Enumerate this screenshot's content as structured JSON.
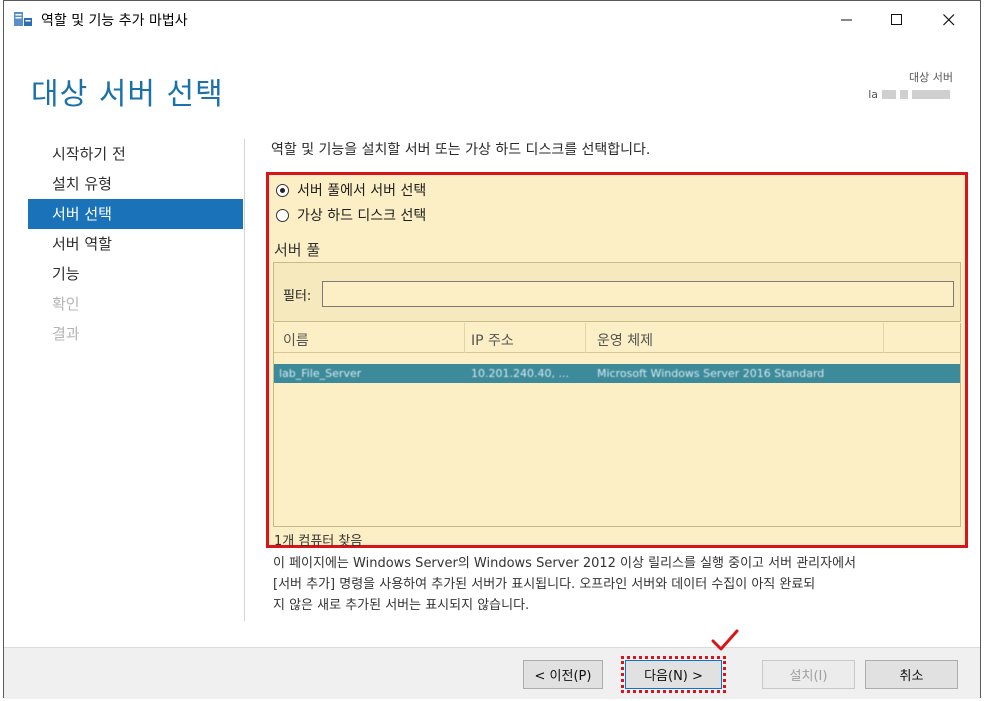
{
  "window": {
    "title": "역할 및 기능 추가 마법사"
  },
  "header": {
    "title": "대상 서버 선택",
    "dest_label": "대상 서버",
    "dest_value": "la"
  },
  "nav": {
    "items": [
      {
        "label": "시작하기 전",
        "state": "normal"
      },
      {
        "label": "설치 유형",
        "state": "normal"
      },
      {
        "label": "서버 선택",
        "state": "active"
      },
      {
        "label": "서버 역할",
        "state": "normal"
      },
      {
        "label": "기능",
        "state": "normal"
      },
      {
        "label": "확인",
        "state": "disabled"
      },
      {
        "label": "결과",
        "state": "disabled"
      }
    ]
  },
  "main": {
    "intro": "역할 및 기능을 설치할 서버 또는 가상 하드 디스크를 선택합니다.",
    "options": [
      {
        "label": "서버 풀에서 서버 선택",
        "selected": true
      },
      {
        "label": "가상 하드 디스크 선택",
        "selected": false
      }
    ],
    "pool_title": "서버 풀",
    "filter_label": "필터:",
    "filter_value": "",
    "columns": [
      "이름",
      "IP 주소",
      "운영 체제"
    ],
    "rows": [
      {
        "name": "lab_File_Server",
        "ip": "10.201.240.40, ...",
        "os": "Microsoft Windows Server 2016 Standard"
      }
    ],
    "count_text": "1개 컴퓨터 찾음",
    "info_lines": [
      "이 페이지에는 Windows Server의 Windows Server 2012 이상 릴리스를 실행 중이고 서버 관리자에서",
      "[서버 추가] 명령을 사용하여 추가된 서버가 표시됩니다. 오프라인 서버와 데이터 수집이 아직 완료되",
      "지 않은 새로 추가된 서버는 표시되지 않습니다."
    ]
  },
  "footer": {
    "prev_label": "< 이전(P)",
    "next_label": "다음(N) >",
    "install_label": "설치(I)",
    "cancel_label": "취소"
  },
  "colors": {
    "accent": "#1a73b8",
    "highlight_border": "#d9141b",
    "panel_bg": "#fcefc6",
    "selected_row": "#3c8a9a"
  }
}
